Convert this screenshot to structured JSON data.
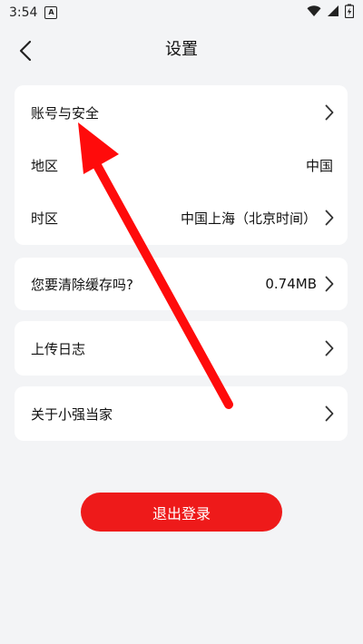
{
  "status_bar": {
    "time": "3:54",
    "badge": "A"
  },
  "header": {
    "title": "设置"
  },
  "settings": {
    "account_security": "账号与安全",
    "region_label": "地区",
    "region_value": "中国",
    "timezone_label": "时区",
    "timezone_value": "中国上海（北京时间）",
    "cache_label": "您要清除缓存吗?",
    "cache_value": "0.74MB",
    "upload_log": "上传日志",
    "about": "关于小强当家"
  },
  "logout_label": "退出登录",
  "colors": {
    "accent": "#ee1a1a",
    "background": "#f3f4f6",
    "card": "#ffffff"
  }
}
